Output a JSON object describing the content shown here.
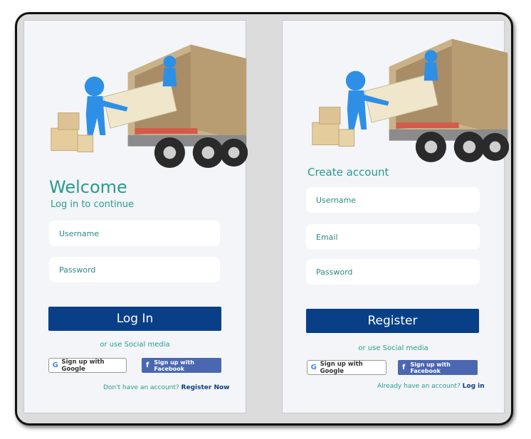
{
  "login": {
    "title": "Welcome",
    "subtitle": "Log in to continue",
    "username_placeholder": "Username",
    "password_placeholder": "Password",
    "login_button": "Log In",
    "social_label": "or use Social media",
    "google_label": "Sign up with Google",
    "facebook_label": "Sign up with Facebook",
    "footer_text": "Don't have an account?",
    "footer_link": "Register Now"
  },
  "register": {
    "title": "Create account",
    "username_placeholder": "Username",
    "email_placeholder": "Email",
    "password_placeholder": "Password",
    "register_button": "Register",
    "social_label": "or use Social media",
    "google_label": "Sign up with Google",
    "facebook_label": "Sign up with Facebook",
    "footer_text": "Already have an account?",
    "footer_link": "Log in"
  },
  "icons": {
    "google": "google-icon",
    "facebook": "facebook-icon",
    "illustration": "moving-truck-illustration"
  },
  "colors": {
    "accent": "#2a9a92",
    "primary_button": "#083f87",
    "facebook": "#4a67b0",
    "panel_background": "#f3f5f8"
  }
}
